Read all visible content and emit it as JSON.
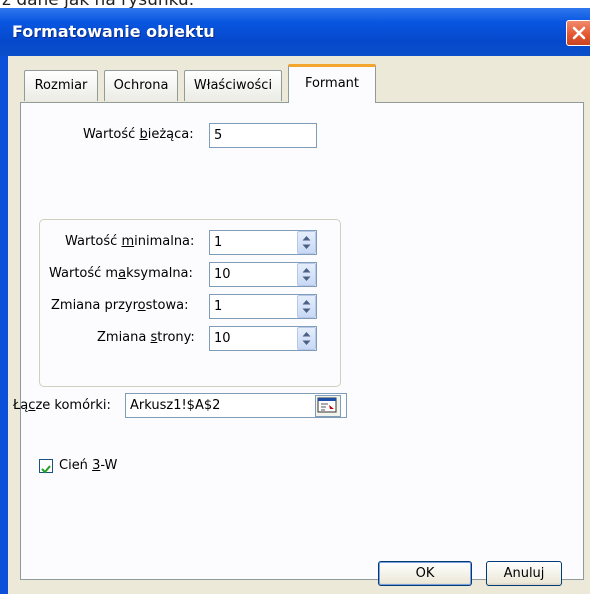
{
  "caption": {
    "text": "z dane jak na rysunku."
  },
  "window": {
    "title": "Formatowanie obiektu",
    "close_icon": "close-icon"
  },
  "tabs": [
    {
      "label": "Rozmiar",
      "active": false
    },
    {
      "label": "Ochrona",
      "active": false
    },
    {
      "label": "Właściwości",
      "active": false
    },
    {
      "label": "Formant",
      "active": true
    }
  ],
  "form": {
    "current_value": {
      "label_pre": "Wartość ",
      "label_u": "b",
      "label_post": "ieżąca:",
      "value": "5"
    },
    "min_value": {
      "label_pre": "Wartość ",
      "label_u": "m",
      "label_post": "inimalna:",
      "value": "1"
    },
    "max_value": {
      "label_pre": "Wartość m",
      "label_u": "a",
      "label_post": "ksymalna:",
      "value": "10"
    },
    "increment": {
      "label_pre": "Zmiana przyr",
      "label_u": "o",
      "label_post": "stowa:",
      "value": "1"
    },
    "page_change": {
      "label_pre": "Zmiana ",
      "label_u": "s",
      "label_post": "trony:",
      "value": "10"
    },
    "cell_link": {
      "label_pre": "Łą",
      "label_u": "c",
      "label_post": "ze komórki:",
      "value": "Arkusz1!$A$2"
    },
    "shadow_3d": {
      "label_pre": "Cień ",
      "label_u": "3",
      "label_post": "-W",
      "checked": true
    }
  },
  "buttons": {
    "ok": "OK",
    "cancel": "Anuluj"
  },
  "colors": {
    "titlebar": "#0856e0",
    "dialog_bg": "#ece9d8",
    "active_tab_accent": "#f4a52d",
    "close_button": "#e3552e"
  },
  "icons": {
    "spinner": "spin-up-down-icon",
    "range_picker": "collapse-dialog-icon",
    "check": "checkmark-icon"
  }
}
